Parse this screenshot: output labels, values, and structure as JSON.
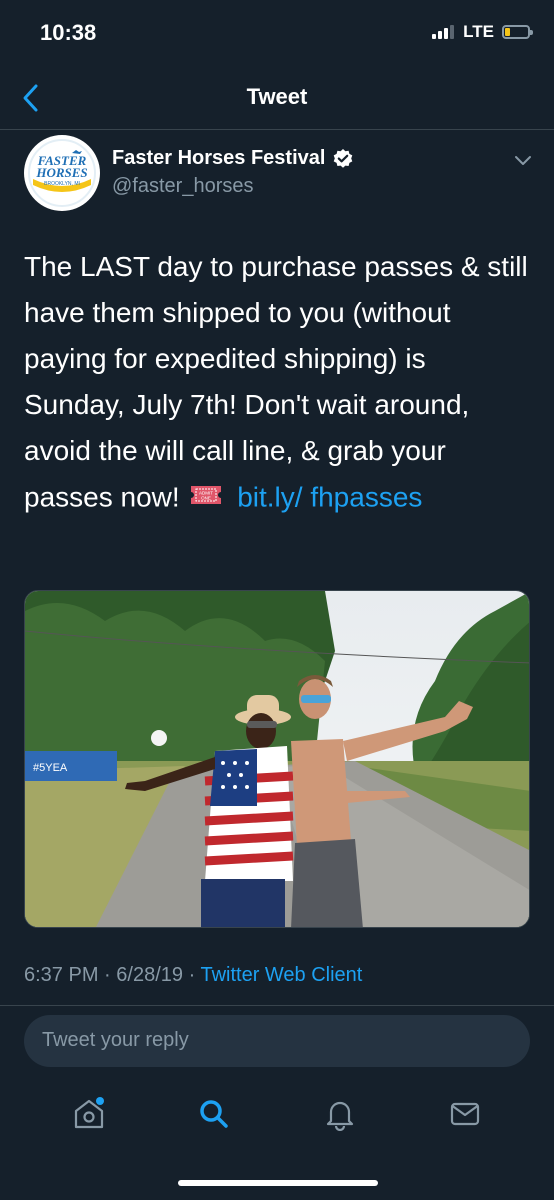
{
  "status_bar": {
    "time": "10:38",
    "network": "LTE",
    "battery_color": "#f5c518"
  },
  "nav": {
    "title": "Tweet",
    "back_icon": "chevron-left-icon"
  },
  "author": {
    "name": "Faster Horses Festival",
    "handle": "@faster_horses",
    "verified": true,
    "avatar_logo_lines": [
      "FASTER",
      "HORSES",
      "BROOKLYN, MI"
    ]
  },
  "tweet": {
    "text": "The LAST day to purchase passes & still have them shipped to you (without paying for expedited shipping) is Sunday, July 7th! Don't wait around, avoid the will call line, & grab your passes now!",
    "emoji": "admission-ticket-icon",
    "link_text": "bit.ly/ fhpasses"
  },
  "photo": {
    "description_icon": "photo-image"
  },
  "meta": {
    "time": "6:37 PM",
    "separator": "·",
    "date": "6/28/19",
    "source": "Twitter Web Client"
  },
  "reply": {
    "placeholder": "Tweet your reply"
  },
  "tabs": [
    {
      "name": "home",
      "icon": "home-icon",
      "active": false,
      "has_dot": true
    },
    {
      "name": "search",
      "icon": "search-icon",
      "active": true
    },
    {
      "name": "notifications",
      "icon": "bell-icon",
      "active": false
    },
    {
      "name": "messages",
      "icon": "envelope-icon",
      "active": false
    }
  ],
  "colors": {
    "background": "#15202b",
    "accent": "#1da1f2",
    "secondary_text": "#8899a6"
  }
}
